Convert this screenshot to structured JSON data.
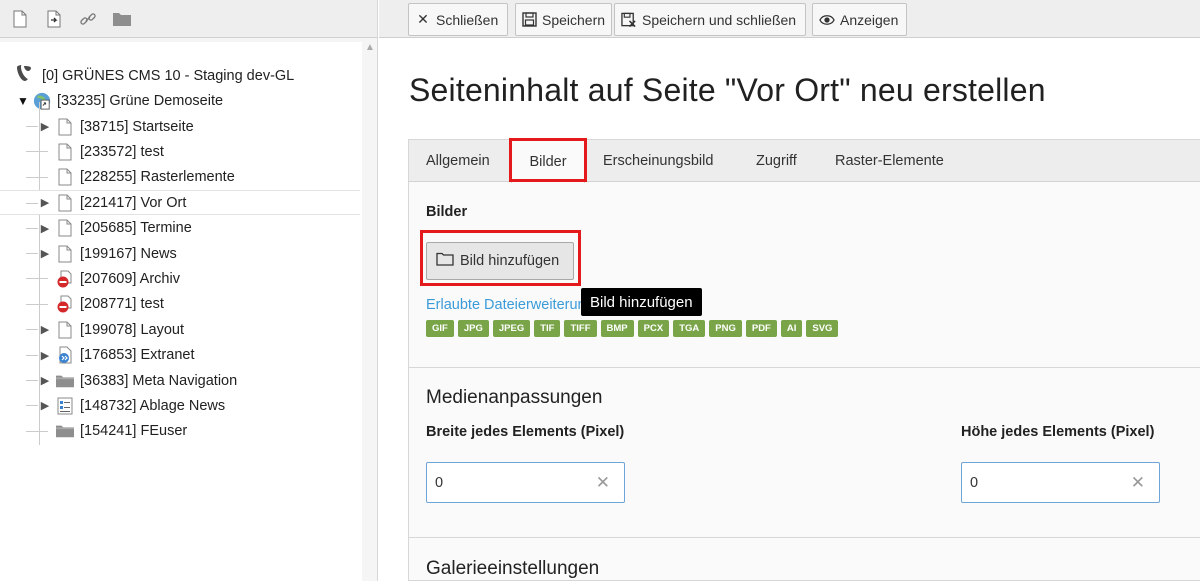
{
  "left_toolbar": {
    "icons": [
      "new-page-icon",
      "new-page-link-icon",
      "link-icon",
      "folder-icon"
    ]
  },
  "tree": {
    "root": "[0] GRÜNES CMS 10 - Staging dev-GL",
    "site": "[33235] Grüne Demoseite",
    "items": [
      {
        "label": "[38715] Startseite",
        "icon": "page-icon",
        "expandable": true
      },
      {
        "label": "[233572] test",
        "icon": "page-icon",
        "expandable": false
      },
      {
        "label": "[228255] Rasterlemente",
        "icon": "page-icon",
        "expandable": false
      },
      {
        "label": "[221417] Vor Ort",
        "icon": "page-icon",
        "expandable": true,
        "selected": true
      },
      {
        "label": "[205685] Termine",
        "icon": "page-icon",
        "expandable": true
      },
      {
        "label": "[199167] News",
        "icon": "page-icon",
        "expandable": true
      },
      {
        "label": "[207609] Archiv",
        "icon": "hidden-page-icon",
        "expandable": false
      },
      {
        "label": "[208771] test",
        "icon": "hidden-page-icon",
        "expandable": false
      },
      {
        "label": "[199078] Layout",
        "icon": "page-icon",
        "expandable": true
      },
      {
        "label": "[176853] Extranet",
        "icon": "shortcut-page-icon",
        "expandable": true
      },
      {
        "label": "[36383] Meta Navigation",
        "icon": "folder-icon",
        "expandable": true
      },
      {
        "label": "[148732] Ablage News",
        "icon": "list-page-icon",
        "expandable": true
      },
      {
        "label": "[154241] FEuser",
        "icon": "folder-icon",
        "expandable": false
      }
    ]
  },
  "toolbar": {
    "close": "Schließen",
    "save": "Speichern",
    "save_close": "Speichern und schließen",
    "view": "Anzeigen"
  },
  "page_title": "Seiteninhalt auf Seite \"Vor Ort\" neu erstellen",
  "tabs": [
    "Allgemein",
    "Bilder",
    "Erscheinungsbild",
    "Zugriff",
    "Raster-Elemente"
  ],
  "active_tab": "Bilder",
  "images_section": {
    "label": "Bilder",
    "add_button": "Bild hinzufügen",
    "tooltip": "Bild hinzufügen",
    "allowed_link": "Erlaubte Dateierweiterungen",
    "extensions": [
      "GIF",
      "JPG",
      "JPEG",
      "TIF",
      "TIFF",
      "BMP",
      "PCX",
      "TGA",
      "PNG",
      "PDF",
      "AI",
      "SVG"
    ]
  },
  "media_section": {
    "heading": "Medienanpassungen",
    "width_label": "Breite jedes Elements (Pixel)",
    "width_value": "0",
    "height_label": "Höhe jedes Elements (Pixel)",
    "height_value": "0"
  },
  "gallery_section": {
    "heading": "Galerieeinstellungen"
  },
  "colors": {
    "highlight": "#e3191b",
    "badge": "#79a548",
    "link": "#3a9bd8",
    "input_border": "#6ea5d8"
  }
}
